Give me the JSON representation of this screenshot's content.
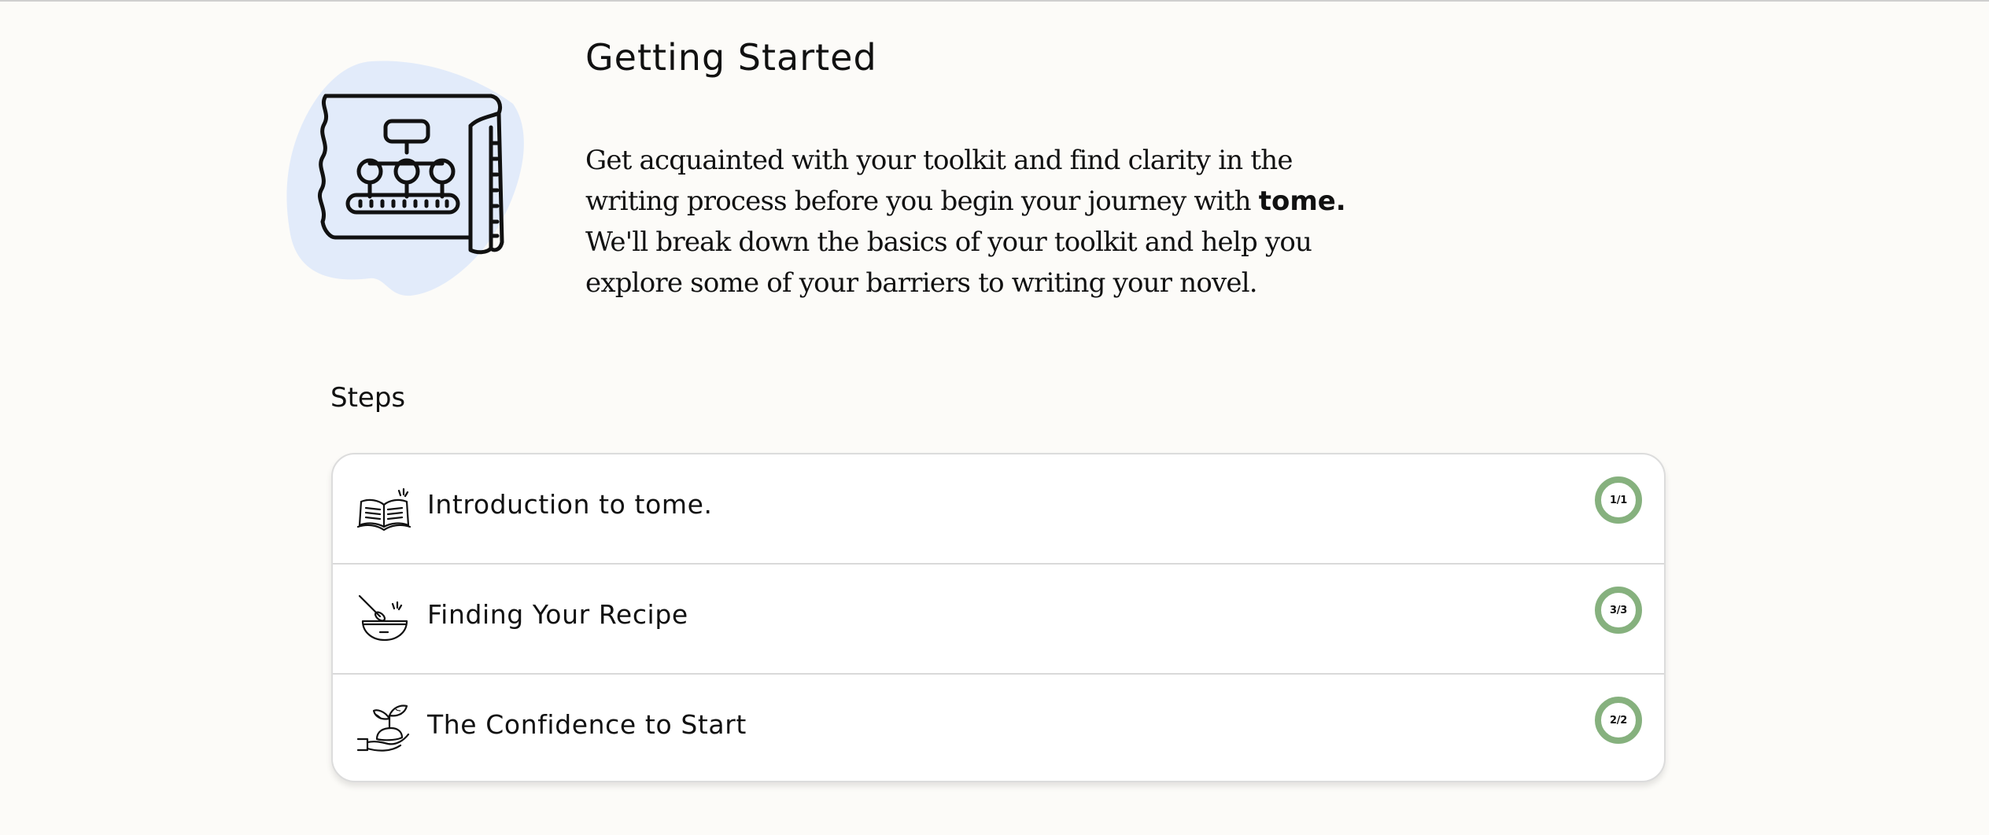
{
  "hero": {
    "title": "Getting Started",
    "description_part1": "Get acquainted with your toolkit and find clarity in the writing process before you begin your journey with ",
    "brand": "tome.",
    "description_part2": " We'll break down the basics of your toolkit and help you explore some of your barriers to writing your novel.",
    "illustration_icon": "blueprint-flowchart-icon",
    "illustration_blob_color": "#e2ebfa"
  },
  "steps": {
    "heading": "Steps",
    "progress_color": "#86b17e",
    "items": [
      {
        "title": "Introduction to tome.",
        "progress": "1/1",
        "icon": "open-book-icon"
      },
      {
        "title": "Finding Your Recipe",
        "progress": "3/3",
        "icon": "mixing-bowl-icon"
      },
      {
        "title": "The Confidence to Start",
        "progress": "2/2",
        "icon": "hand-sprout-icon"
      }
    ]
  }
}
